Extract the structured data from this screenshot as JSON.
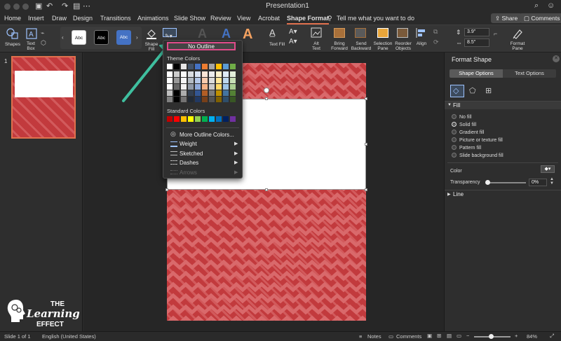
{
  "window": {
    "title": "Presentation1"
  },
  "tabs": [
    "Home",
    "Insert",
    "Draw",
    "Design",
    "Transitions",
    "Animations",
    "Slide Show",
    "Review",
    "View",
    "Acrobat",
    "Shape Format"
  ],
  "active_tab": "Shape Format",
  "tell_me": "Tell me what you want to do",
  "share_label": "Share",
  "comments_label": "Comments",
  "ribbon": {
    "shapes": "Shapes",
    "text_box": "Text\nBox",
    "abc": "Abc",
    "shape_fill": "Shape\nFill",
    "text_fill": "Text Fill",
    "alt_text": "Alt\nText",
    "bring_forward": "Bring\nForward",
    "send_backward": "Send\nBackward",
    "selection_pane": "Selection\nPane",
    "reorder_objects": "Reorder\nObjects",
    "align": "Align",
    "height_value": "3.9\"",
    "width_value": "8.5\"",
    "format_pane": "Format\nPane"
  },
  "slide_panel": {
    "slide_number": "1"
  },
  "outline_menu": {
    "no_outline": "No Outline",
    "theme_colors_label": "Theme Colors",
    "standard_colors_label": "Standard Colors",
    "more_colors": "More Outline Colors...",
    "weight": "Weight",
    "sketched": "Sketched",
    "dashes": "Dashes",
    "arrows": "Arrows",
    "theme_top_row": [
      "#ffffff",
      "#000000",
      "#e7e6e6",
      "#44546a",
      "#4472c4",
      "#ed7d31",
      "#a5a5a5",
      "#ffc000",
      "#5b9bd5",
      "#70ad47"
    ],
    "standard_colors": [
      "#c00000",
      "#ff0000",
      "#ffc000",
      "#ffff00",
      "#92d050",
      "#00b050",
      "#00b0f0",
      "#0070c0",
      "#002060",
      "#7030a0"
    ]
  },
  "format_shape": {
    "title": "Format Shape",
    "shape_options_tab": "Shape Options",
    "text_options_tab": "Text Options",
    "fill_section": "Fill",
    "fill_options": [
      "No fill",
      "Solid fill",
      "Gradient fill",
      "Picture or texture fill",
      "Pattern fill",
      "Slide background fill"
    ],
    "selected_fill": "Solid fill",
    "color_label": "Color",
    "transparency_label": "Transparency",
    "transparency_value": "0%",
    "line_section": "Line"
  },
  "watermark": {
    "line1": "THE",
    "line2": "Learning",
    "line3": "EFFECT"
  },
  "status": {
    "slide_of": "Slide 1 of 1",
    "language": "English (United States)",
    "notes": "Notes",
    "comments": "Comments",
    "zoom": "84%"
  },
  "colors": {
    "accent": "#e0704d",
    "slide_red": "#c23a3d",
    "highlight_box": "#e04b8a",
    "arrow": "#3fbf9f"
  }
}
